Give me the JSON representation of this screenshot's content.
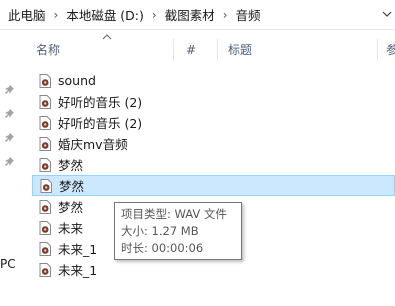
{
  "breadcrumb": {
    "items": [
      "此电脑",
      "本地磁盘 (D:)",
      "截图素材",
      "音频"
    ],
    "separator": "›"
  },
  "nav": {
    "pc_label": "PC"
  },
  "columns": {
    "name": "名称",
    "number": "#",
    "title": "标题",
    "extra": "参"
  },
  "files": [
    {
      "name": "sound"
    },
    {
      "name": "好听的音乐 (2)"
    },
    {
      "name": "好听的音乐 (2)"
    },
    {
      "name": "婚庆mv音频"
    },
    {
      "name": "梦然"
    },
    {
      "name": "梦然"
    },
    {
      "name": "梦然"
    },
    {
      "name": "未来"
    },
    {
      "name": "未来_1"
    },
    {
      "name": "未来_1"
    }
  ],
  "hovered_index": 5,
  "tooltip": {
    "type": "项目类型: WAV 文件",
    "size": "大小: 1.27 MB",
    "duration": "时长: 00:00:06"
  },
  "colors": {
    "hover_bg": "#cce8ff",
    "hover_border": "#99d1ff",
    "header_text": "#4c607a"
  }
}
